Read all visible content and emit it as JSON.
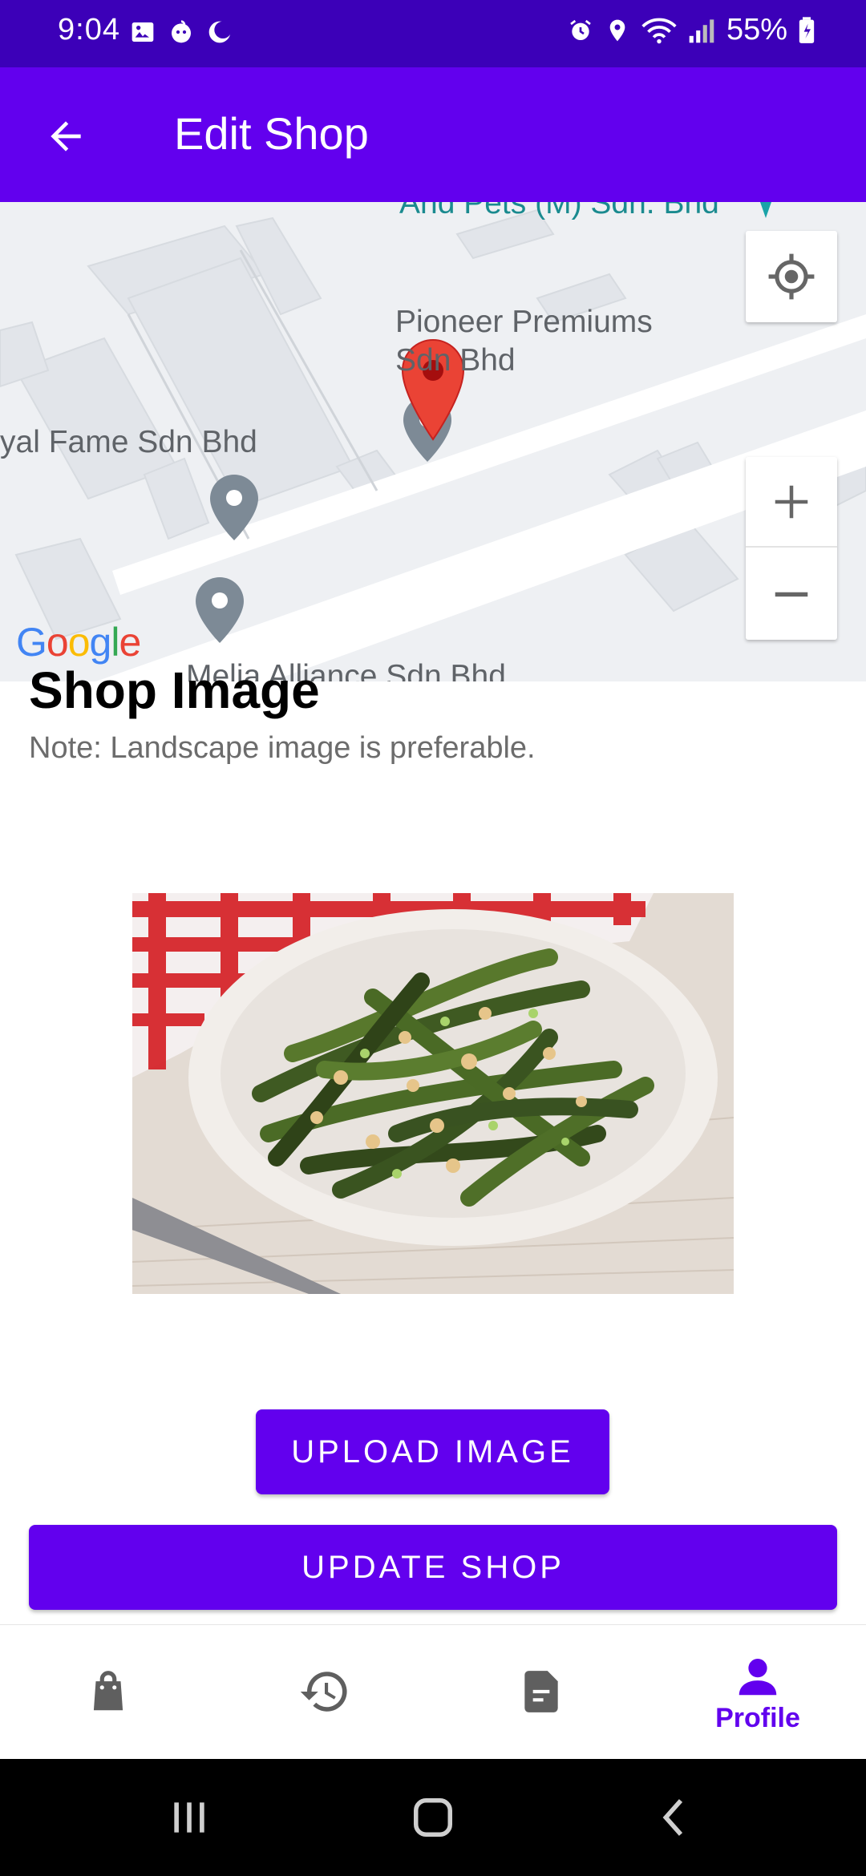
{
  "status_bar": {
    "time": "9:04",
    "battery": "55%",
    "left_icons": [
      "gallery-icon",
      "app-notification-icon",
      "moon-icon"
    ],
    "right_icons": [
      "alarm-icon",
      "location-icon",
      "wifi-icon",
      "signal-icon",
      "battery-icon"
    ]
  },
  "app_bar": {
    "title": "Edit Shop",
    "back_icon": "arrow-back-icon"
  },
  "map": {
    "labels": {
      "top": "And Pets (M) Sdn. Bhd",
      "pioneer_line1": "Pioneer Premiums",
      "pioneer_line2": "Sdn Bhd",
      "royal": "yal Fame Sdn Bhd",
      "bottom": "Melia Alliance Sdn Bhd"
    },
    "google_logo": "Google",
    "controls": [
      "my-location-icon",
      "zoom-in-icon",
      "zoom-out-icon"
    ],
    "marker_color": "#ea4335"
  },
  "content": {
    "section_title": "Shop Image",
    "note": "Note: Landscape image is preferable.",
    "image": "grilled green beans with peanuts on a white plate"
  },
  "buttons": {
    "upload": "UPLOAD IMAGE",
    "update": "UPDATE SHOP"
  },
  "bottom_nav": {
    "items": [
      {
        "icon": "shopping-bag-icon",
        "label": ""
      },
      {
        "icon": "history-icon",
        "label": ""
      },
      {
        "icon": "document-icon",
        "label": ""
      },
      {
        "icon": "person-icon",
        "label": "Profile"
      }
    ],
    "active_index": 3
  },
  "colors": {
    "primary": "#6200ee",
    "status_bar": "#3c00b8"
  }
}
